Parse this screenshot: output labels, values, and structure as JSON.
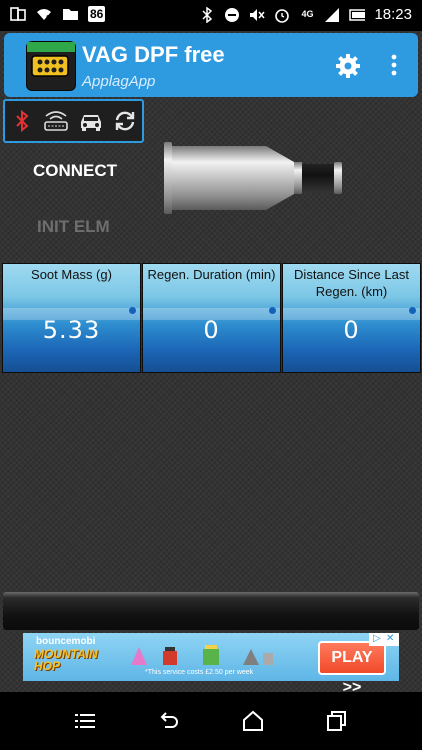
{
  "status_bar": {
    "notification_count": "86",
    "network": "4G",
    "time": "18:23"
  },
  "app_bar": {
    "title": "VAG DPF free",
    "subtitle": "ApplagApp"
  },
  "controls": {
    "connect_label": "CONNECT",
    "init_label": "INIT ELM"
  },
  "gauges": [
    {
      "label": "Soot Mass (g)",
      "value": "5.33"
    },
    {
      "label": "Regen. Duration (min)",
      "value": "0"
    },
    {
      "label": "Distance Since Last Regen. (km)",
      "value": "0"
    }
  ],
  "ad": {
    "brand": "bouncemobi",
    "game_line1": "MOUNTAIN",
    "game_line2": "HOP",
    "disclaimer": "*This service costs £2.50 per week",
    "cta": "PLAY >>"
  },
  "colors": {
    "accent": "#2e9ae0",
    "disabled_text": "#6e6e6e"
  }
}
